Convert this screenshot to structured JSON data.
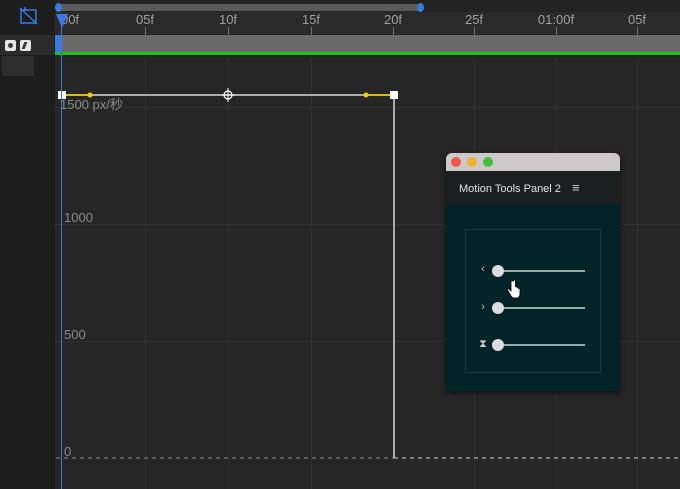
{
  "ruler": {
    "labels": [
      "00f",
      "05f",
      "10f",
      "15f",
      "20f",
      "25f",
      "01:00f",
      "05f"
    ]
  },
  "graph": {
    "speed_label": "1500 px/秒",
    "y_labels": [
      "1000",
      "500",
      "0"
    ]
  },
  "panel": {
    "title": "Motion Tools Panel 2",
    "menu_icon": "hamburger-menu-icon",
    "sliders": [
      {
        "icon": "ease-in-icon",
        "symbol": "‹",
        "value": 0
      },
      {
        "icon": "ease-out-icon",
        "symbol": "›",
        "value": 0
      },
      {
        "icon": "hourglass-icon",
        "symbol": "⧗",
        "value": 0
      }
    ]
  },
  "colors": {
    "playhead": "#3a7adf",
    "keyframe_handle": "#f0d000",
    "layer_green": "#20c020",
    "panel_bg": "#022428"
  }
}
